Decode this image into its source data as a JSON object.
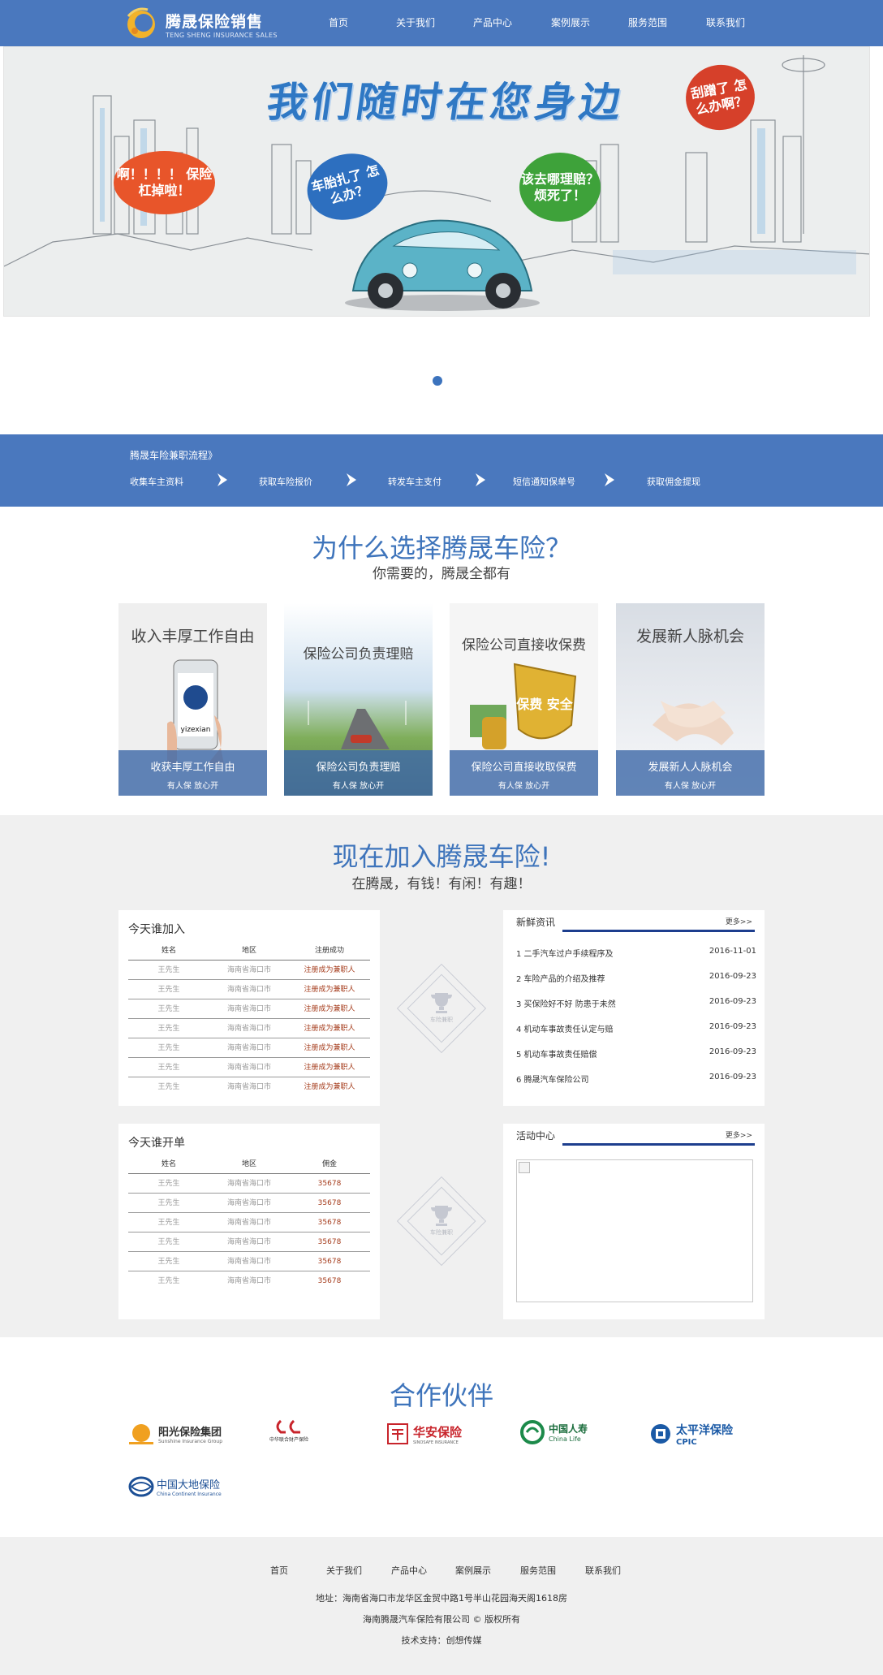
{
  "header": {
    "logo_cn": "腾晟保险销售",
    "logo_en": "TENG SHENG INSURANCE SALES",
    "nav": [
      "首页",
      "关于我们",
      "产品中心",
      "案例展示",
      "服务范围",
      "联系我们"
    ],
    "bg_color": "#4a78be"
  },
  "banner": {
    "headline": "我们随时在您身边",
    "bubbles": [
      "啊！！！！ 保险杠掉啦！",
      "车胎扎了 怎么办？",
      "该去哪理赔？ 烦死了！",
      "刮蹭了 怎么办啊？"
    ]
  },
  "process": {
    "title": "腾晟车险兼职流程》",
    "steps": [
      "收集车主资料",
      "获取车险报价",
      "转发车主支付",
      "短信通知保单号",
      "获取佣金提现"
    ]
  },
  "why": {
    "title": "为什么选择腾晟车险？",
    "subtitle": "你需要的，腾晟全都有",
    "cards": [
      {
        "top": "收入丰厚工作自由",
        "caption": "收获丰厚工作自由",
        "tag": "有人保 放心开",
        "image_text": "yizexian"
      },
      {
        "top": "保险公司负责理赔",
        "caption": "保险公司负责理赔",
        "tag": "有人保 放心开"
      },
      {
        "top": "保险公司直接收保费",
        "caption": "保险公司直接收取保费",
        "tag": "有人保 放心开",
        "image_text": "保费 安全"
      },
      {
        "top": "发展新人脉机会",
        "caption": "发展新人人脉机会",
        "tag": "有人保 放心开"
      }
    ]
  },
  "join": {
    "title": "现在加入腾晟车险!",
    "subtitle": "在腾晟，有钱！有闲！有趣！",
    "today_join": {
      "title": "今天谁加入",
      "headers": [
        "姓名",
        "地区",
        "注册成功"
      ],
      "rows": [
        [
          "王先生",
          "海南省海口市",
          "注册成为兼职人"
        ],
        [
          "王先生",
          "海南省海口市",
          "注册成为兼职人"
        ],
        [
          "王先生",
          "海南省海口市",
          "注册成为兼职人"
        ],
        [
          "王先生",
          "海南省海口市",
          "注册成为兼职人"
        ],
        [
          "王先生",
          "海南省海口市",
          "注册成为兼职人"
        ],
        [
          "王先生",
          "海南省海口市",
          "注册成为兼职人"
        ],
        [
          "王先生",
          "海南省海口市",
          "注册成为兼职人"
        ]
      ]
    },
    "today_order": {
      "title": "今天谁开单",
      "headers": [
        "姓名",
        "地区",
        "佣金"
      ],
      "rows": [
        [
          "王先生",
          "海南省海口市",
          "35678"
        ],
        [
          "王先生",
          "海南省海口市",
          "35678"
        ],
        [
          "王先生",
          "海南省海口市",
          "35678"
        ],
        [
          "王先生",
          "海南省海口市",
          "35678"
        ],
        [
          "王先生",
          "海南省海口市",
          "35678"
        ],
        [
          "王先生",
          "海南省海口市",
          "35678"
        ]
      ]
    },
    "badge_text": "车险兼职",
    "news": {
      "title": "新鲜资讯",
      "more": "更多>>",
      "items": [
        {
          "text": "1 二手汽车过户手续程序及",
          "date": "2016-11-01"
        },
        {
          "text": "2 车险产品的介绍及推荐",
          "date": "2016-09-23"
        },
        {
          "text": "3 买保险好不好 防患于未然",
          "date": "2016-09-23"
        },
        {
          "text": "4 机动车事故责任认定与赔",
          "date": "2016-09-23"
        },
        {
          "text": "5 机动车事故责任赔偿",
          "date": "2016-09-23"
        },
        {
          "text": "6 腾晟汽车保险公司",
          "date": "2016-09-23"
        }
      ]
    },
    "activity": {
      "title": "活动中心",
      "more": "更多>>"
    }
  },
  "partners": {
    "title": "合作伙伴",
    "items": [
      {
        "cn": "阳光保险集团",
        "en": "Sunshine Insurance Group"
      },
      {
        "cn": "中华联合财产保险",
        "en": ""
      },
      {
        "cn": "华安保险",
        "en": "SINOSAFE INSURANCE"
      },
      {
        "cn": "中国人寿",
        "en": "China Life"
      },
      {
        "cn": "太平洋保险",
        "en": "CPIC"
      },
      {
        "cn": "中国大地保险",
        "en": "China Continent Insurance"
      }
    ]
  },
  "footer": {
    "nav": [
      "首页",
      "关于我们",
      "产品中心",
      "案例展示",
      "服务范围",
      "联系我们"
    ],
    "address": "地址：海南省海口市龙华区金贸中路1号半山花园海天阁1618房",
    "copyright": "海南腾晟汽车保险有限公司 © 版权所有",
    "support": "技术支持：创想传媒"
  }
}
